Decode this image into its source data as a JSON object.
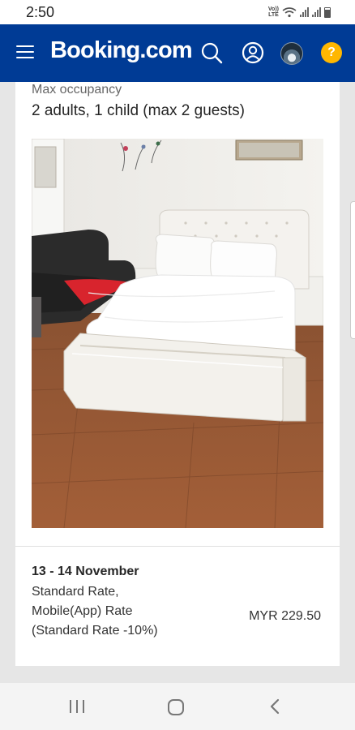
{
  "status_bar": {
    "time": "2:50",
    "volte_top": "Vo))",
    "volte_bottom": "LTE",
    "icons": [
      "volte-icon",
      "wifi-icon",
      "signal-icon",
      "signal-icon",
      "battery-icon"
    ]
  },
  "header": {
    "brand": "Booking.com",
    "brand_color": "#003b95",
    "help_label": "?",
    "help_color": "#ffb700",
    "icons": [
      "menu-icon",
      "search-icon",
      "account-icon",
      "avatar",
      "help-icon"
    ]
  },
  "room": {
    "occupancy_label": "Max occupancy",
    "occupancy_value": "2 adults, 1 child (max 2 guests)",
    "photo": "bedroom-photo"
  },
  "rate": {
    "dates": "13 - 14 November",
    "lines": [
      "Standard Rate,",
      "Mobile(App) Rate",
      "(Standard Rate -10%)"
    ],
    "price": "MYR 229.50"
  },
  "nav": {
    "icons": [
      "recent-apps-icon",
      "home-icon",
      "back-icon"
    ]
  }
}
